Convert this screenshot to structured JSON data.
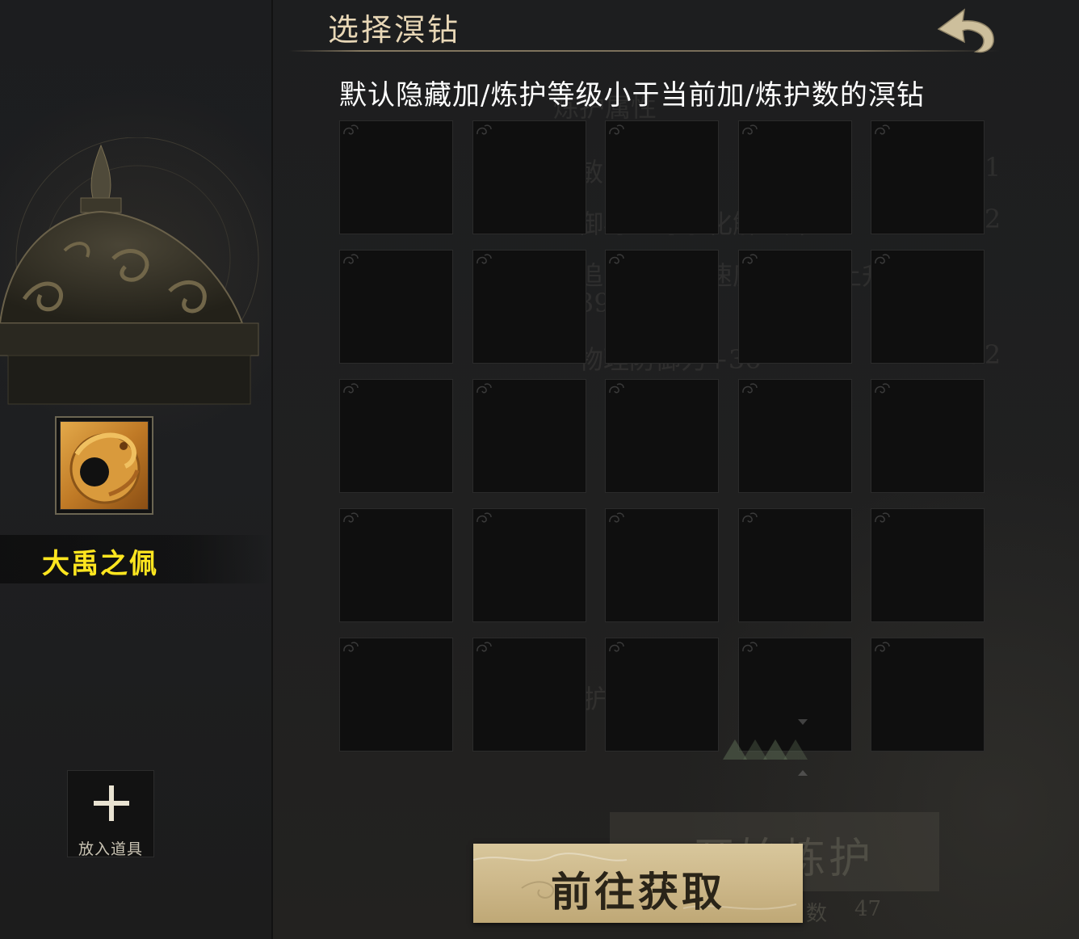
{
  "header": {
    "title": "选择溟钻",
    "back_icon": "back-arrow-icon"
  },
  "hint": "默认隐藏加/炼护等级小于当前加/炼护数的溟钻",
  "item": {
    "name": "大禹之佩",
    "name_color": "#ffe61f",
    "icon": "jade-dragon-pendant-icon"
  },
  "add_slot": {
    "icon": "plus-icon",
    "label": "放入道具"
  },
  "grid": {
    "rows": 5,
    "cols": 5,
    "slots": 25
  },
  "background_text": {
    "section_title": "炼护属性",
    "stat_1": "敏+33",
    "stat_1_bonus": "+1",
    "stat_2": "御毒：毒系化解上升37",
    "stat_2_bonus": "+2",
    "stat_3": "追电：移动速度加成力上升",
    "stat_3_cont": "39",
    "stat_4": "物理防御力+36",
    "stat_4_bonus": "+2",
    "refine_value_label": "炼护值",
    "start_refine": "开始炼护",
    "count_label": "数",
    "count_value": "47"
  },
  "go_button": {
    "label": "前往获取"
  },
  "colors": {
    "title": "#e8d7b6",
    "hint": "#ffffff",
    "button_bg": "#d8c79c",
    "button_text": "#2a2418"
  }
}
